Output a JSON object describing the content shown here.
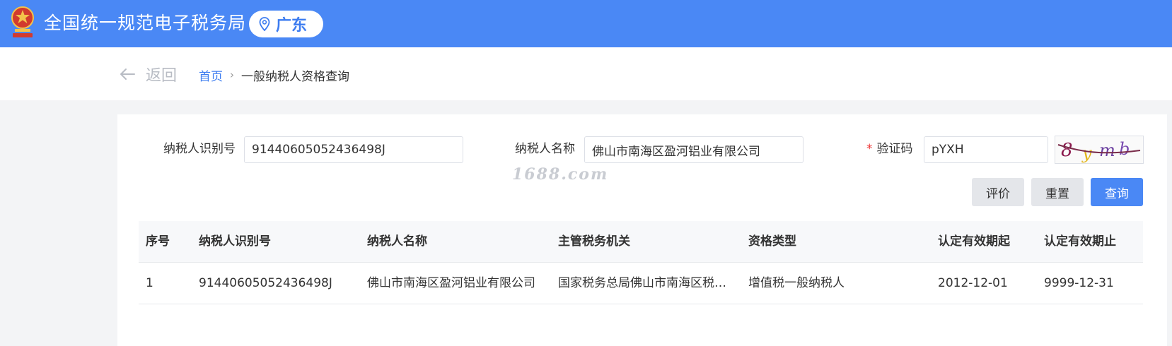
{
  "header": {
    "site_title": "全国统一规范电子税务局",
    "region": "广东",
    "emblem_icon": "national-emblem-icon",
    "region_icon": "location-pin-icon"
  },
  "nav": {
    "back_label": "返回",
    "breadcrumb": {
      "home": "首页",
      "separator": "›",
      "current": "一般纳税人资格查询"
    }
  },
  "form": {
    "taxpayer_id_label": "纳税人识别号",
    "taxpayer_id_value": "91440605052436498J",
    "taxpayer_name_label": "纳税人名称",
    "taxpayer_name_value": "佛山市南海区盈河铝业有限公司",
    "captcha_label": "验证码",
    "captcha_required_mark": "*",
    "captcha_value": "pYXH",
    "captcha_image_text": "8ymb"
  },
  "watermark": "1688.com",
  "buttons": {
    "rate": "评价",
    "reset": "重置",
    "query": "查询"
  },
  "table": {
    "columns": [
      "序号",
      "纳税人识别号",
      "纳税人名称",
      "主管税务机关",
      "资格类型",
      "认定有效期起",
      "认定有效期止"
    ],
    "rows": [
      [
        "1",
        "91440605052436498J",
        "佛山市南海区盈河铝业有限公司",
        "国家税务总局佛山市南海区税…",
        "增值税一般纳税人",
        "2012-12-01",
        "9999-12-31"
      ]
    ]
  },
  "colors": {
    "brand_blue": "#4a88f5",
    "link_blue": "#3c7cf0",
    "required_red": "#e33"
  }
}
